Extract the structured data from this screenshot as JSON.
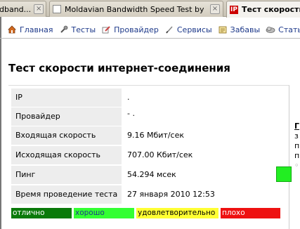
{
  "tabs": [
    {
      "title": "dband...",
      "close": "×"
    },
    {
      "title": "Moldavian Bandwidth Speed Test by I...",
      "close": "×"
    },
    {
      "title": "Тест скорости",
      "favicon_text": "IP"
    }
  ],
  "nav": [
    {
      "label": "Главная",
      "icon": "home-icon"
    },
    {
      "label": "Тесты",
      "icon": "wrench-icon"
    },
    {
      "label": "Провайдер",
      "icon": "pencil-icon"
    },
    {
      "label": "Сервисы",
      "icon": "pen-icon"
    },
    {
      "label": "Забавы",
      "icon": "notes-icon"
    },
    {
      "label": "Статьи",
      "icon": "cloud-icon"
    }
  ],
  "page_title": "Тест скорости интернет-соединения",
  "results": [
    {
      "label": "IP",
      "value": "."
    },
    {
      "label": "Провайдер",
      "value": "-                    ."
    },
    {
      "label": "Входящая скорость",
      "value": "9.16 Мбит/сек"
    },
    {
      "label": "Исходящая скорость",
      "value": "707.00 Кбит/сек"
    },
    {
      "label": "Пинг",
      "value": "54.294 мсек"
    },
    {
      "label": "Время проведение теста",
      "value": "27 января 2010 12:53"
    }
  ],
  "ping_status_color": "#22ee22",
  "legend": [
    {
      "label": "отлично",
      "color": "#0a7a0a",
      "text_color": "#ffffff"
    },
    {
      "label": "хорошо",
      "color": "#33ff33",
      "text_color": "#1e3a8a"
    },
    {
      "label": "удовлетворительно",
      "color": "#ffff33",
      "text_color": "#000000"
    },
    {
      "label": "плохо",
      "color": "#ee1111",
      "text_color": "#ffffff"
    }
  ],
  "sidebar_fragment": [
    "Г",
    "з",
    "п",
    "п",
    "◦"
  ]
}
